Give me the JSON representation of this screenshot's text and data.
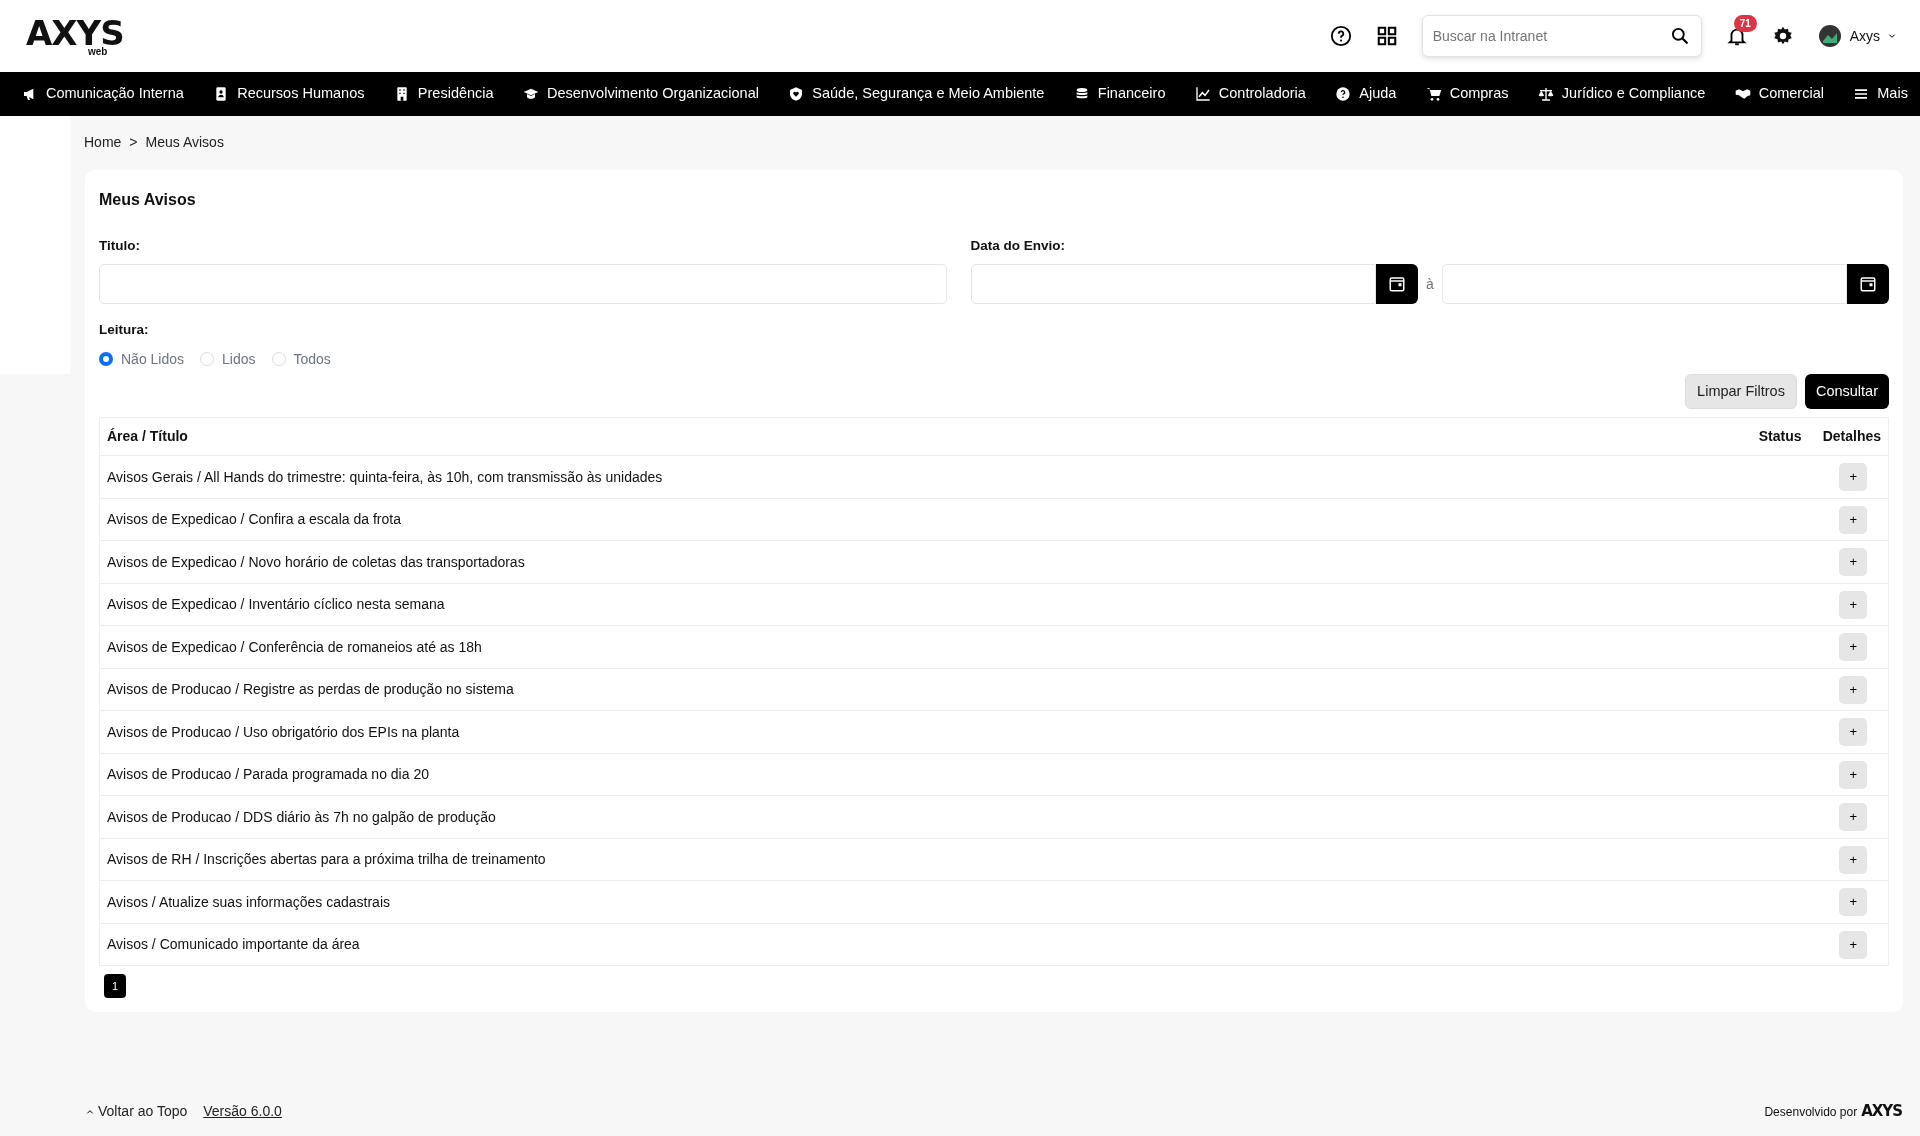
{
  "header": {
    "logo": "AXYS",
    "logo_sub": "web",
    "search": {
      "placeholder": "Buscar na Intranet"
    },
    "notifications_count": "71",
    "user": "Axys"
  },
  "nav": [
    {
      "label": "Comunicação Interna"
    },
    {
      "label": "Recursos Humanos"
    },
    {
      "label": "Presidência"
    },
    {
      "label": "Desenvolvimento Organizacional"
    },
    {
      "label": "Saúde, Segurança e Meio Ambiente"
    },
    {
      "label": "Financeiro"
    },
    {
      "label": "Controladoria"
    },
    {
      "label": "Ajuda"
    },
    {
      "label": "Compras"
    },
    {
      "label": "Jurídico e Compliance"
    },
    {
      "label": "Comercial"
    },
    {
      "label": "Mais"
    }
  ],
  "breadcrumb": [
    "Home",
    ">",
    "Meus Avisos"
  ],
  "panel": {
    "title": "Meus Avisos",
    "filters": {
      "title_label": "Titulo:",
      "date_label": "Data do Envio:",
      "date_separator": "à",
      "reading_label": "Leitura:",
      "reading_options": [
        {
          "label": "Não Lidos",
          "selected": true
        },
        {
          "label": "Lidos",
          "selected": false
        },
        {
          "label": "Todos",
          "selected": false
        }
      ]
    },
    "buttons": [
      "Limpar Filtros",
      "Consultar"
    ],
    "table": {
      "columns": [
        "Área / Título",
        "Status",
        "Detalhes"
      ],
      "rows": [
        {
          "title": "Avisos Gerais / All Hands do trimestre: quinta-feira, às 10h, com transmissão às unidades",
          "action": "+"
        },
        {
          "title": "Avisos de Expedicao / Confira a escala da frota",
          "action": "+"
        },
        {
          "title": "Avisos de Expedicao / Novo horário de coletas das transportadoras",
          "action": "+"
        },
        {
          "title": "Avisos de Expedicao / Inventário cíclico nesta semana",
          "action": "+"
        },
        {
          "title": "Avisos de Expedicao / Conferência de romaneios até as 18h",
          "action": "+"
        },
        {
          "title": "Avisos de Producao / Registre as perdas de produção no sistema",
          "action": "+"
        },
        {
          "title": "Avisos de Producao / Uso obrigatório dos EPIs na planta",
          "action": "+"
        },
        {
          "title": "Avisos de Producao / Parada programada no dia 20",
          "action": "+"
        },
        {
          "title": "Avisos de Producao / DDS diário às 7h no galpão de produção",
          "action": "+"
        },
        {
          "title": "Avisos de RH / Inscrições abertas para a próxima trilha de treinamento",
          "action": "+"
        },
        {
          "title": "Avisos / Atualize suas informações cadastrais",
          "action": "+"
        },
        {
          "title": "Avisos / Comunicado importante da área",
          "action": "+"
        }
      ]
    },
    "pagination": [
      {
        "label": "1",
        "selected": true
      }
    ]
  },
  "footer": {
    "back_to_top": "Voltar ao Topo",
    "version": "Versão 6.0.0",
    "developed_by": "Desenvolvido por",
    "brand": "AXYS"
  }
}
